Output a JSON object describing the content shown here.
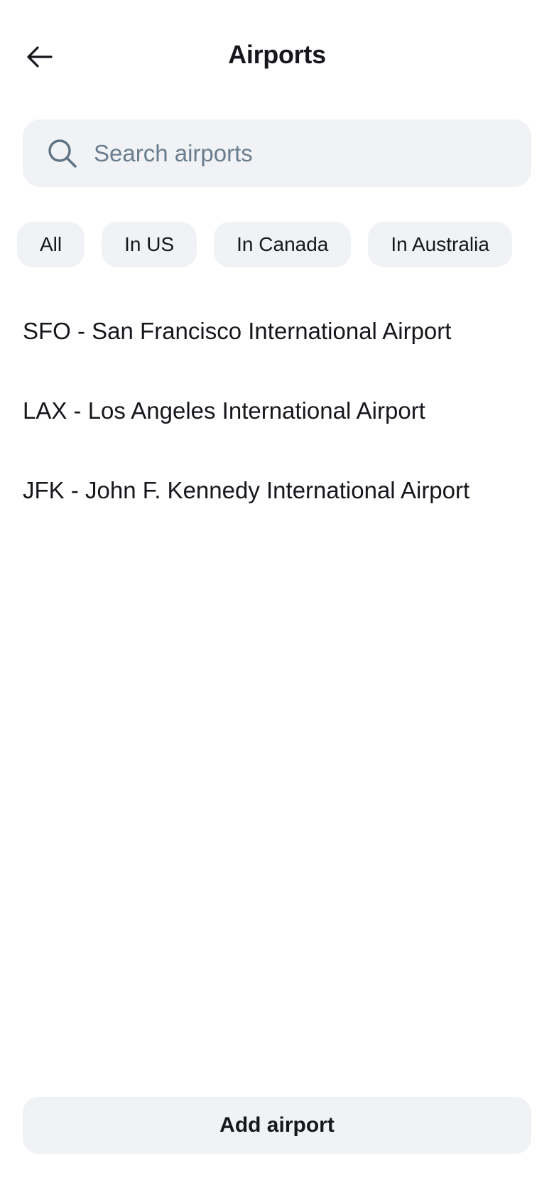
{
  "header": {
    "title": "Airports",
    "back_icon": "arrow-left-icon"
  },
  "search": {
    "placeholder": "Search airports",
    "value": "",
    "icon": "search-icon"
  },
  "filters": [
    {
      "label": "All"
    },
    {
      "label": "In US"
    },
    {
      "label": "In Canada"
    },
    {
      "label": "In Australia"
    }
  ],
  "airports": [
    {
      "label": "SFO - San Francisco International Airport"
    },
    {
      "label": "LAX - Los Angeles International Airport"
    },
    {
      "label": "JFK - John F. Kennedy International Airport"
    }
  ],
  "footer": {
    "add_label": "Add airport"
  },
  "colors": {
    "surface": "#f0f2f5",
    "text": "#15171c",
    "placeholder": "#6a7d8e",
    "icon_muted": "#5f7384"
  }
}
